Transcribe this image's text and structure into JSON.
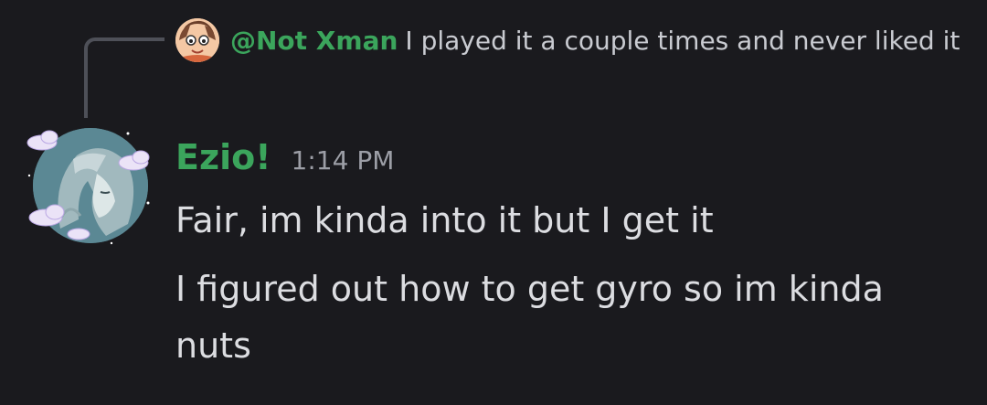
{
  "reply": {
    "author": "@Not Xman",
    "text": "I played it a couple times and never liked it"
  },
  "message": {
    "author": "Ezio!",
    "timestamp": "1:14 PM",
    "lines": [
      "Fair, im kinda into it but I get it",
      "I figured out how to get gyro so im kinda nuts"
    ]
  },
  "colors": {
    "background": "#1a1a1e",
    "author_green": "#3ba55c",
    "text": "#dcdde1",
    "muted": "#9c9ea6"
  }
}
